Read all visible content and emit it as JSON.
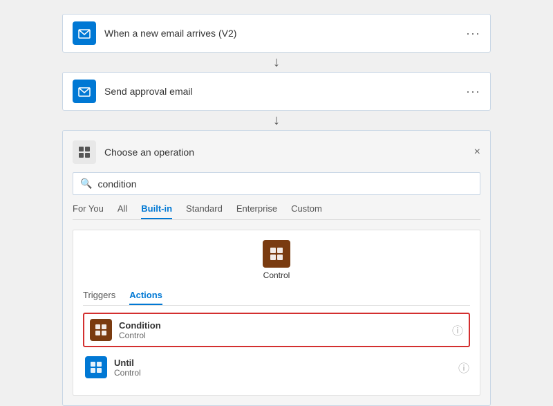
{
  "steps": [
    {
      "id": "step-email",
      "title": "When a new email arrives (V2)",
      "iconColor": "#0078d4"
    },
    {
      "id": "step-approval",
      "title": "Send approval email",
      "iconColor": "#0078d4"
    }
  ],
  "choosePanel": {
    "title": "Choose an operation",
    "search": {
      "placeholder": "condition",
      "value": "condition"
    },
    "filterTabs": [
      {
        "label": "For You",
        "active": false
      },
      {
        "label": "All",
        "active": false
      },
      {
        "label": "Built-in",
        "active": true
      },
      {
        "label": "Standard",
        "active": false
      },
      {
        "label": "Enterprise",
        "active": false
      },
      {
        "label": "Custom",
        "active": false
      }
    ],
    "controlItem": {
      "label": "Control"
    },
    "subTabs": [
      {
        "label": "Triggers",
        "active": false
      },
      {
        "label": "Actions",
        "active": true
      }
    ],
    "actions": [
      {
        "name": "Condition",
        "sub": "Control",
        "highlighted": true
      },
      {
        "name": "Until",
        "sub": "Control",
        "highlighted": false
      }
    ]
  },
  "icons": {
    "more": "···",
    "arrowDown": "↓",
    "close": "×",
    "search": "🔍",
    "info": "ⓘ"
  }
}
